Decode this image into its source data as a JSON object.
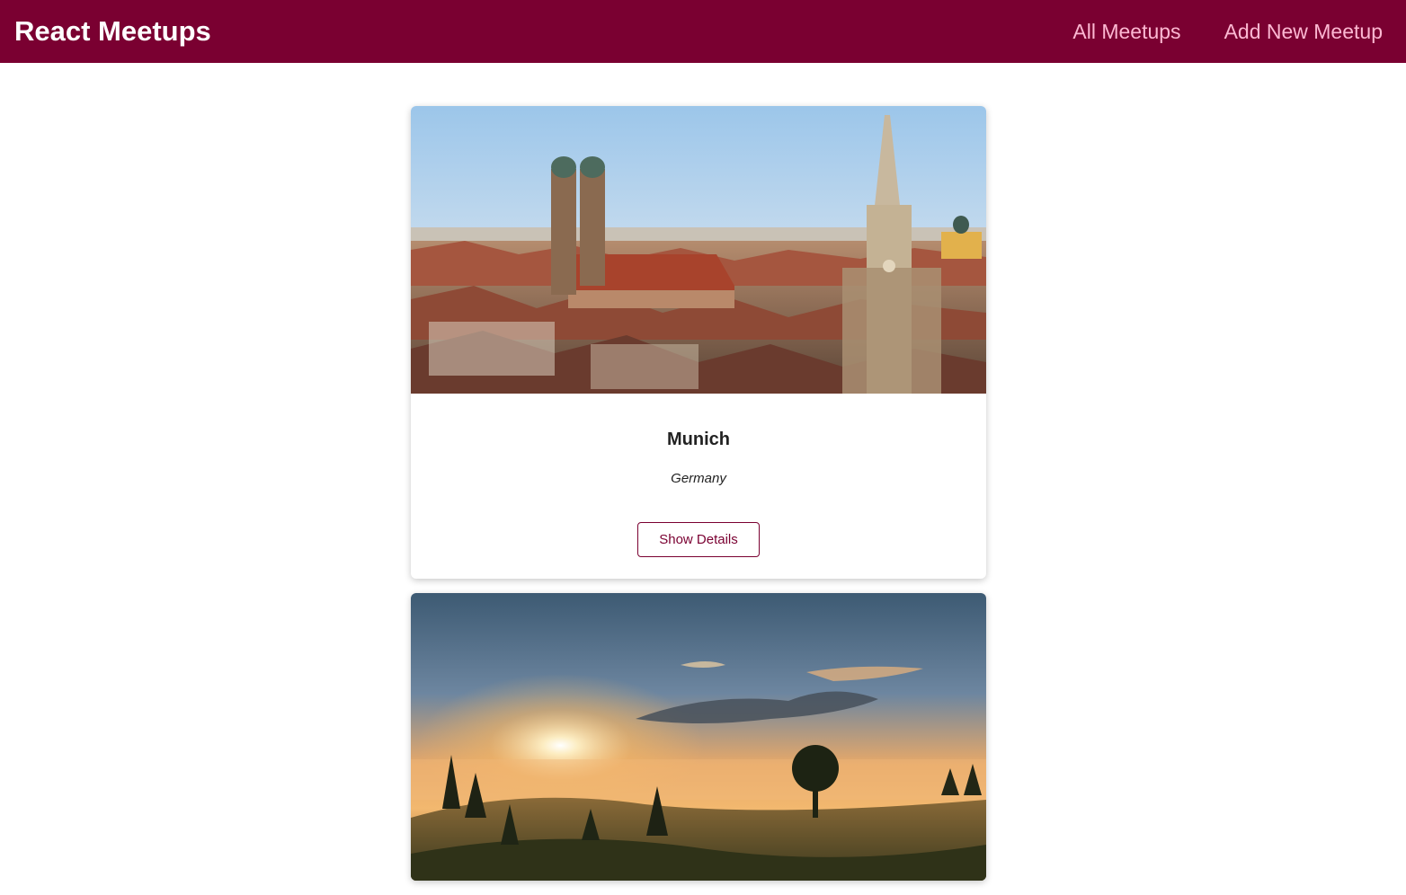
{
  "header": {
    "logo": "React Meetups",
    "nav": [
      {
        "label": "All Meetups"
      },
      {
        "label": "Add New Meetup"
      }
    ]
  },
  "meetups": [
    {
      "title": "Munich",
      "subtitle": "Germany",
      "button_label": "Show Details",
      "image": "munich-cityscape"
    },
    {
      "image": "sunrise-landscape"
    }
  ],
  "colors": {
    "brand": "#7a0031",
    "nav_link": "#fcb8d2"
  }
}
